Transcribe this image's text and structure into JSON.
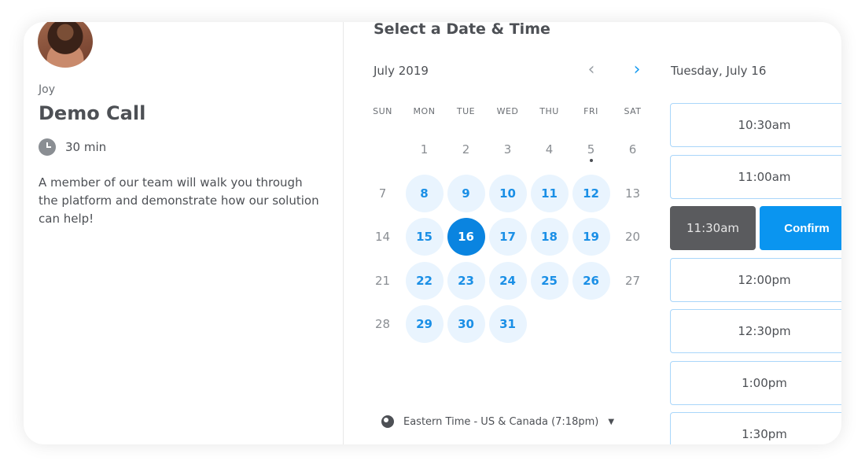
{
  "host": {
    "name": "Joy"
  },
  "event": {
    "title": "Demo Call",
    "duration": "30 min",
    "description": "A member of our team will walk you through the platform and demonstrate how our solution can help!"
  },
  "calendar": {
    "heading": "Select a Date & Time",
    "month": "July 2019",
    "weekdays": [
      "SUN",
      "MON",
      "TUE",
      "WED",
      "THU",
      "FRI",
      "SAT"
    ],
    "days": [
      {
        "n": "1",
        "state": "unavailable"
      },
      {
        "n": "2",
        "state": "unavailable"
      },
      {
        "n": "3",
        "state": "unavailable"
      },
      {
        "n": "4",
        "state": "unavailable"
      },
      {
        "n": "5",
        "state": "today"
      },
      {
        "n": "6",
        "state": "unavailable"
      },
      {
        "n": "7",
        "state": "unavailable"
      },
      {
        "n": "8",
        "state": "available"
      },
      {
        "n": "9",
        "state": "available"
      },
      {
        "n": "10",
        "state": "available"
      },
      {
        "n": "11",
        "state": "available"
      },
      {
        "n": "12",
        "state": "available"
      },
      {
        "n": "13",
        "state": "unavailable"
      },
      {
        "n": "14",
        "state": "unavailable"
      },
      {
        "n": "15",
        "state": "available"
      },
      {
        "n": "16",
        "state": "selected"
      },
      {
        "n": "17",
        "state": "available"
      },
      {
        "n": "18",
        "state": "available"
      },
      {
        "n": "19",
        "state": "available"
      },
      {
        "n": "20",
        "state": "unavailable"
      },
      {
        "n": "21",
        "state": "unavailable"
      },
      {
        "n": "22",
        "state": "available"
      },
      {
        "n": "23",
        "state": "available"
      },
      {
        "n": "24",
        "state": "available"
      },
      {
        "n": "25",
        "state": "available"
      },
      {
        "n": "26",
        "state": "available"
      },
      {
        "n": "27",
        "state": "unavailable"
      },
      {
        "n": "28",
        "state": "unavailable"
      },
      {
        "n": "29",
        "state": "available"
      },
      {
        "n": "30",
        "state": "available"
      },
      {
        "n": "31",
        "state": "available"
      }
    ],
    "timezone": "Eastern Time - US & Canada (7:18pm)"
  },
  "times": {
    "date_heading": "Tuesday, July 16",
    "slots": [
      "10:30am",
      "11:00am",
      "11:30am",
      "12:00pm",
      "12:30pm",
      "1:00pm",
      "1:30pm"
    ],
    "selected": "11:30am",
    "confirm_label": "Confirm"
  },
  "colors": {
    "accent": "#0a84e0",
    "available_bg": "#e9f4fe",
    "selected_slot_bg": "#5a5b5e"
  }
}
